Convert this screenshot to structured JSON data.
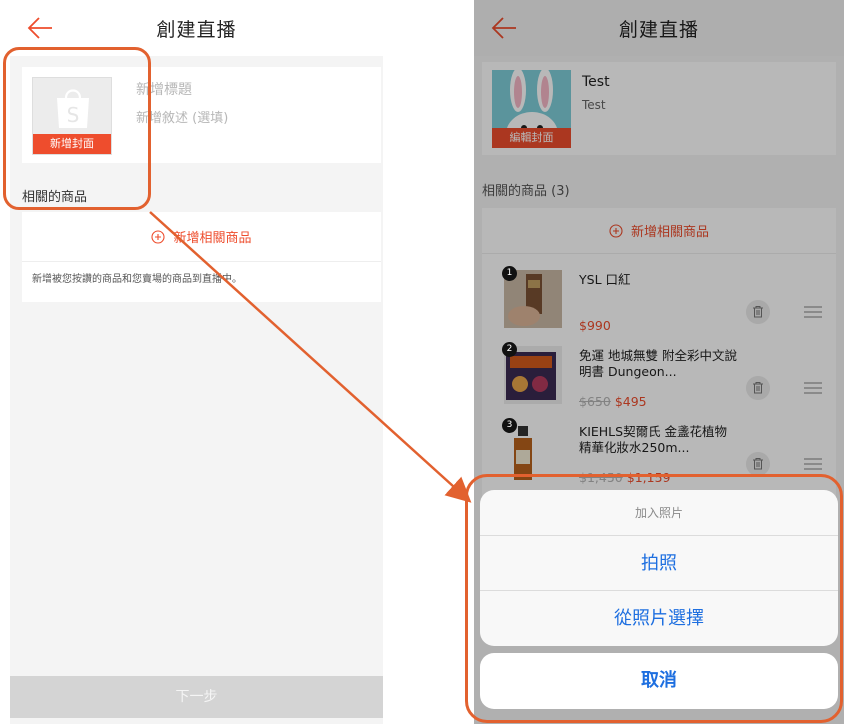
{
  "left_screen": {
    "nav": {
      "title": "創建直播",
      "back_icon": "arrow-left-icon"
    },
    "cover": {
      "label": "新增封面",
      "icon": "shopping-bag-icon",
      "title_placeholder": "新增標題",
      "desc_placeholder": "新增敘述 (選填)"
    },
    "related": {
      "section_label": "相關的商品",
      "add_label": "新增相關商品",
      "hint": "新增被您按讚的商品和您賣場的商品到直播中。"
    },
    "next_label": "下一步"
  },
  "right_screen": {
    "nav": {
      "title": "創建直播",
      "back_icon": "arrow-left-icon"
    },
    "cover": {
      "label": "編輯封面",
      "title": "Test",
      "desc": "Test"
    },
    "related": {
      "section_label": "相關的商品 (3)",
      "add_label": "新增相關商品",
      "products": [
        {
          "num": "1",
          "name": "YSL 口紅",
          "orig_price": "",
          "price": "$990"
        },
        {
          "num": "2",
          "name": "免運 地城無雙 附全彩中文說明書 Dungeon...",
          "orig_price": "$650",
          "price": "$495"
        },
        {
          "num": "3",
          "name": "KIEHLS契爾氏 金盞花植物精華化妝水250m...",
          "orig_price": "$1,450",
          "price": "$1,159"
        }
      ]
    },
    "sheet": {
      "title": "加入照片",
      "options": [
        "拍照",
        "從照片選擇"
      ],
      "cancel": "取消"
    }
  },
  "colors": {
    "accent": "#ee4d2d",
    "annotation": "#e2612f",
    "ios_blue": "#1e6fe0"
  }
}
